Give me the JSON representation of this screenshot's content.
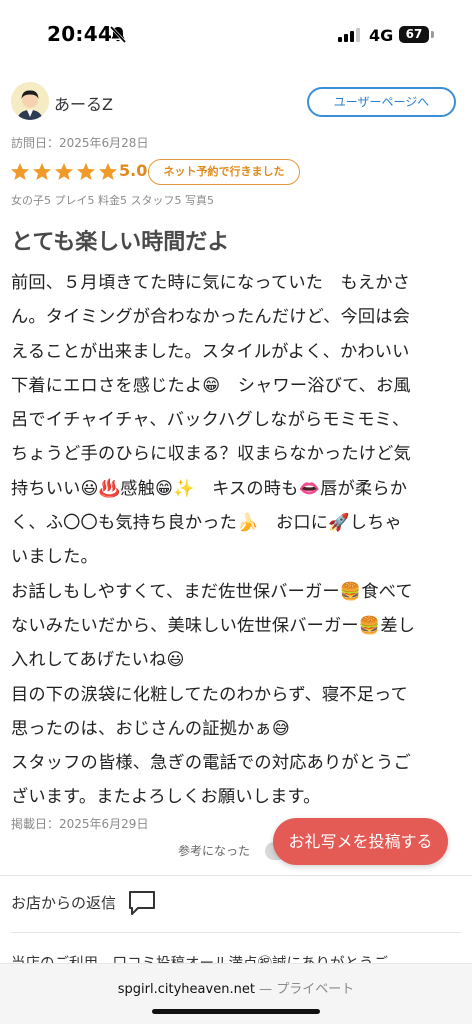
{
  "status_bar": {
    "time": "20:44",
    "network": "4G",
    "battery": "67"
  },
  "reviewer": {
    "name": "あーるZ",
    "user_page_label": "ユーザーページへ",
    "visit_date": "訪問日：2025年6月28日"
  },
  "rating": {
    "stars": 5,
    "value": "5.0",
    "badge": "ネット予約で行きました",
    "sub_ratings": "女の子5 プレイ5 料金5 スタッフ5 写真5",
    "star_color": "#f09a2a"
  },
  "review": {
    "title": "とても楽しい時間だよ",
    "lines": [
      "前回、５月頃きてた時に気になっていた　もえかさ",
      "ん。タイミングが合わなかったんだけど、今回は会",
      "えることが出来ました。スタイルがよく、かわいい",
      "下着にエロさを感じたよ😁　シャワー浴びて、お風",
      "呂でイチャイチャ、バックハグしながらモミモミ、",
      "ちょうど手のひらに収まる？収まらなかったけど気",
      "持ちいい😃♨️感触😁✨　キスの時も👄唇が柔らか",
      "く、ふ〇〇も気持ち良かった🍌　お口に🚀しちゃ",
      "いました。",
      "お話しもしやすくて、まだ佐世保バーガー🍔食べて",
      "ないみたいだから、美味しい佐世保バーガー🍔差し",
      "入れしてあげたいね😃",
      "目の下の涙袋に化粧してたのわからず、寝不足って",
      "思ったのは、おじさんの証拠かぁ😅",
      "スタッフの皆様、急ぎの電話での対応ありがとうご",
      "ざいます。またよろしくお願いします。"
    ],
    "post_date": "掲載日：2025年6月29日",
    "helpful_label": "参考になった",
    "post_photo_button": "お礼写メを投稿する"
  },
  "shop_reply": {
    "heading": "お店からの返信",
    "preview": "当店のご利用、口コミ投稿オール満点㊗誠にありがとうご"
  },
  "browser": {
    "domain": "spgirl.cityheaven.net",
    "mode": "— プライベート"
  },
  "colors": {
    "accent_blue": "#3b8fd8",
    "accent_orange": "#e08a1e",
    "button_red": "#e45a55"
  }
}
